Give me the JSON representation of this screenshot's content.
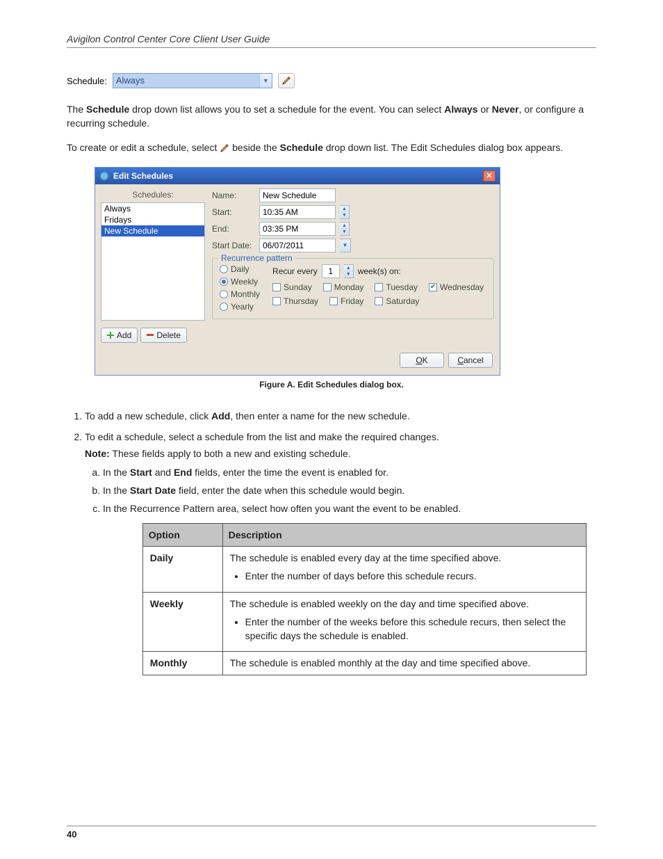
{
  "header": "Avigilon Control Center Core Client User Guide",
  "page_number": "40",
  "schedule_row": {
    "label": "Schedule:",
    "value": "Always"
  },
  "para1_a": "The ",
  "para1_b": "Schedule",
  "para1_c": " drop down list allows you to set a schedule for the event. You can select ",
  "para1_d": "Always",
  "para1_e": " or ",
  "para1_f": "Never",
  "para1_g": ", or configure a recurring schedule.",
  "para2_a": "To create or edit a schedule, select ",
  "para2_b": " beside the ",
  "para2_c": "Schedule",
  "para2_d": " drop down list. The Edit Schedules dialog box appears.",
  "dialog": {
    "title": "Edit Schedules",
    "schedules_label": "Schedules:",
    "list": [
      "Always",
      "Fridays",
      "New Schedule"
    ],
    "selected_index": 2,
    "add_label": "Add",
    "delete_label": "Delete",
    "fields": {
      "name_label": "Name:",
      "name_value": "New Schedule",
      "start_label": "Start:",
      "start_value": "10:35 AM",
      "end_label": "End:",
      "end_value": "03:35 PM",
      "start_date_label": "Start Date:",
      "start_date_value": "06/07/2011"
    },
    "recur": {
      "title": "Recurrence pattern",
      "daily": "Daily",
      "weekly": "Weekly",
      "monthly": "Monthly",
      "yearly": "Yearly",
      "recur_every": "Recur every",
      "recur_value": "1",
      "weeks_on": "week(s) on:",
      "days": {
        "sunday": "Sunday",
        "monday": "Monday",
        "tuesday": "Tuesday",
        "wednesday": "Wednesday",
        "thursday": "Thursday",
        "friday": "Friday",
        "saturday": "Saturday"
      },
      "checked_day": "wednesday",
      "selected_radio": "weekly"
    },
    "ok": "OK",
    "cancel": "Cancel"
  },
  "figure_caption": "Figure A.    Edit Schedules dialog box.",
  "steps": {
    "1_a": "To add a new schedule, click ",
    "1_b": "Add",
    "1_c": ", then enter a name for the new schedule.",
    "2_a": "To edit a schedule, select a schedule from the list and make the required changes.",
    "sub_a1": "In the ",
    "sub_a2": "Start",
    "sub_a3": " and ",
    "sub_a4": "End",
    "sub_a5": " fields, enter the time the event is enabled for.",
    "sub_b1": "In the ",
    "sub_b2": "Start Date",
    "sub_b3": " field, enter the date when this schedule would begin.",
    "sub_c1": "In the Recurrence Pattern area, select how often you want the event to be enabled.",
    "note_label": "Note:",
    "note_text": " These fields apply to both a new and existing schedule.",
    "table": {
      "h1": "Option",
      "h2": "Description",
      "daily_label": "Daily",
      "daily_desc": "The schedule is enabled every day at the time specified above.",
      "daily_bul": "Enter the number of days before this schedule recurs.",
      "weekly_label": "Weekly",
      "weekly_desc": "The schedule is enabled weekly on the day and time specified above.",
      "weekly_bul": "Enter the number of the weeks before this schedule recurs, then select the specific days the schedule is enabled.",
      "monthly_label": "Monthly",
      "monthly_desc": "The schedule is enabled monthly at the day and time specified above."
    }
  }
}
